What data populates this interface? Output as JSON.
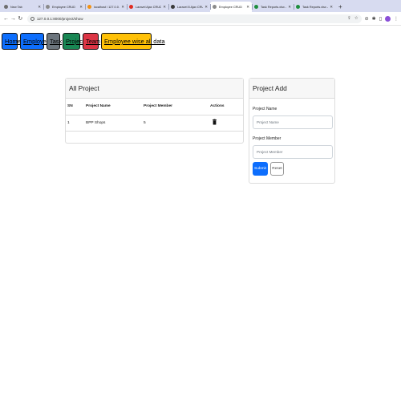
{
  "browser": {
    "tabs": [
      {
        "title": "New Tab",
        "color": "#6e6e6e"
      },
      {
        "title": "Employee CRUD",
        "color": "#8a8a8a"
      },
      {
        "title": "localhost / 127.0.0.1 / 23...",
        "color": "#f29111"
      },
      {
        "title": "Laravel Ajax CRUD Tutorial...",
        "color": "#e02b20"
      },
      {
        "title": "Laravel 8 Ajax CRUD with...",
        "color": "#3a3a3a"
      },
      {
        "title": "Employee CRUD",
        "color": "#8a8a8a"
      },
      {
        "title": "Task Reports.xlsx - Google...",
        "color": "#1e8e3e"
      },
      {
        "title": "Task Reports.xlsx - Google...",
        "color": "#1e8e3e"
      }
    ],
    "active_tab_index": 5,
    "url": "127.0.0.1:8000/project/show"
  },
  "nav": {
    "home": "Home",
    "employee": "Employee",
    "task": "Task",
    "project": "Project",
    "team": "Team",
    "employee_wise": "Employee wise all data"
  },
  "project_list": {
    "title": "All Project",
    "columns": [
      "SN",
      "Project Name",
      "Project Member",
      "Actions"
    ],
    "rows": [
      {
        "sn": "1",
        "name": "BPP Shops",
        "member": "5",
        "action_icon": "trash-icon"
      }
    ]
  },
  "project_add": {
    "title": "Project Add",
    "name_label": "Project Name",
    "name_placeholder": "Project Name",
    "member_label": "Project Member",
    "member_placeholder": "Project Member",
    "submit_label": "Submit",
    "reset_label": "Reset"
  },
  "colors": {
    "primary": "#0d6efd",
    "secondary": "#6c757d",
    "success": "#198754",
    "danger": "#dc3545",
    "warning": "#ffc107"
  }
}
